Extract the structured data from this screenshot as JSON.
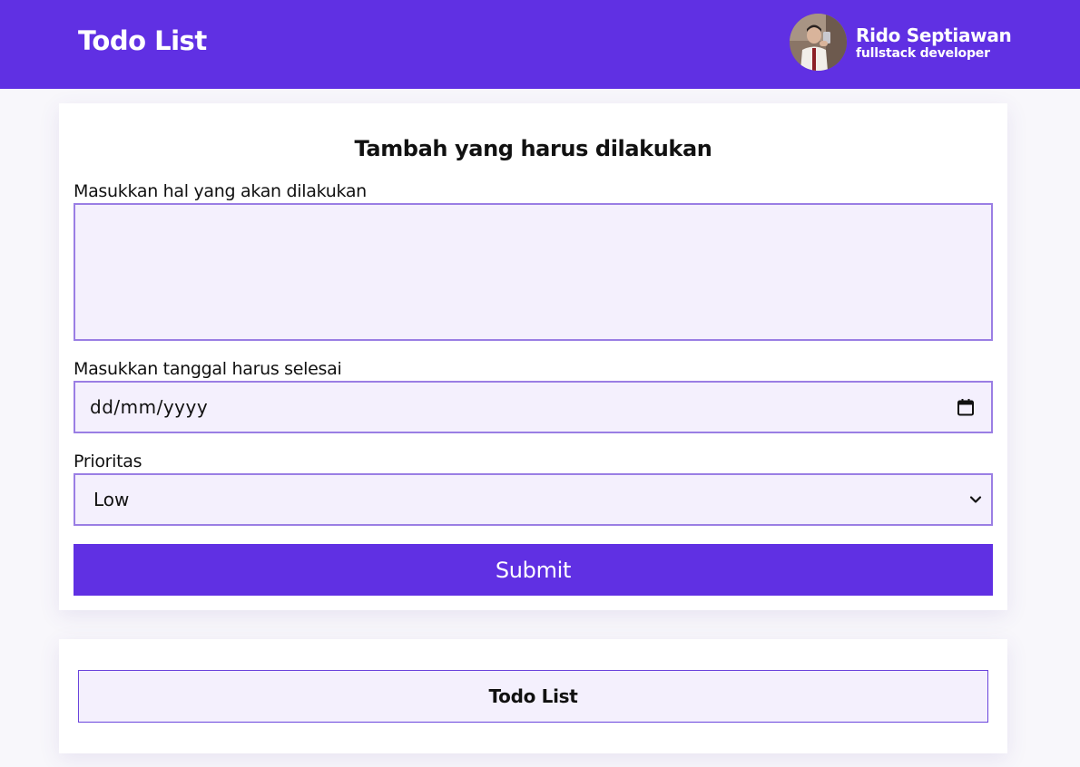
{
  "header": {
    "title": "Todo List",
    "profile": {
      "name": "Rido Septiawan",
      "role": "fullstack developer"
    }
  },
  "form": {
    "title": "Tambah yang harus dilakukan",
    "task_label": "Masukkan hal yang akan dilakukan",
    "task_value": "",
    "date_label": "Masukkan tanggal harus selesai",
    "date_placeholder": "dd/mm/yyyy",
    "priority_label": "Prioritas",
    "priority_selected": "Low",
    "submit_label": "Submit"
  },
  "list": {
    "header": "Todo List"
  },
  "colors": {
    "brand": "#6030e3",
    "field_bg": "#f4f0fd",
    "field_border": "#9a7ee4"
  },
  "icons": {
    "date": "calendar-icon",
    "select": "chevron-down-icon"
  }
}
